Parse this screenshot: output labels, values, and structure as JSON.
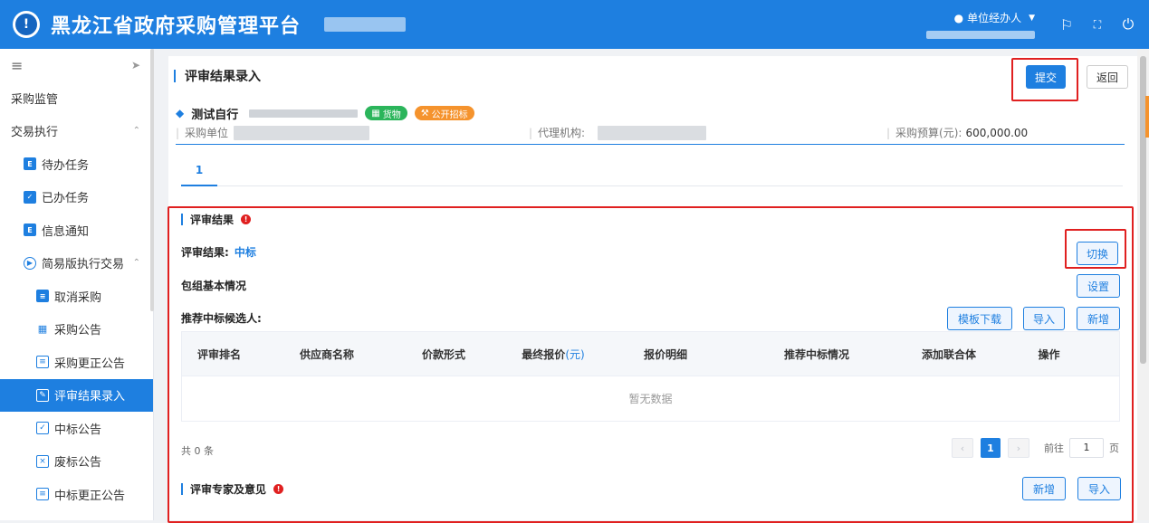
{
  "header": {
    "title": "黑龙江省政府采购管理平台",
    "user_role": "单位经办人"
  },
  "sidebar": {
    "items": [
      {
        "label": "采购监管"
      },
      {
        "label": "交易执行"
      },
      {
        "label": "待办任务"
      },
      {
        "label": "已办任务"
      },
      {
        "label": "信息通知"
      },
      {
        "label": "简易版执行交易"
      },
      {
        "label": "取消采购"
      },
      {
        "label": "采购公告"
      },
      {
        "label": "采购更正公告"
      },
      {
        "label": "评审结果录入"
      },
      {
        "label": "中标公告"
      },
      {
        "label": "废标公告"
      },
      {
        "label": "中标更正公告"
      }
    ]
  },
  "page": {
    "title": "评审结果录入",
    "submit_label": "提交",
    "back_label": "返回"
  },
  "project": {
    "name": "测试自行",
    "tag_goods": "货物",
    "tag_method": "公开招标",
    "purchaser_label": "采购单位",
    "agency_label": "代理机构:",
    "budget_label": "采购预算(元):",
    "budget_value": "600,000.00"
  },
  "tabs": [
    "1"
  ],
  "review": {
    "section_title": "评审结果",
    "result_label": "评审结果:",
    "result_value": "中标",
    "switch_label": "切换",
    "package_label": "包组基本情况",
    "settings_label": "设置",
    "candidates_label": "推荐中标候选人:",
    "template_download_label": "模板下载",
    "import_label": "导入",
    "add_label": "新增",
    "columns": [
      "评审排名",
      "供应商名称",
      "价款形式",
      "最终报价",
      "(元)",
      "报价明细",
      "推荐中标情况",
      "添加联合体",
      "操作"
    ],
    "empty_text": "暂无数据",
    "total_text": "共 0 条",
    "pager": {
      "current": "1",
      "goto_label": "前往",
      "goto_value": "1",
      "page_unit": "页"
    }
  },
  "experts": {
    "section_title": "评审专家及意见",
    "add_label": "新增",
    "import_label": "导入"
  }
}
